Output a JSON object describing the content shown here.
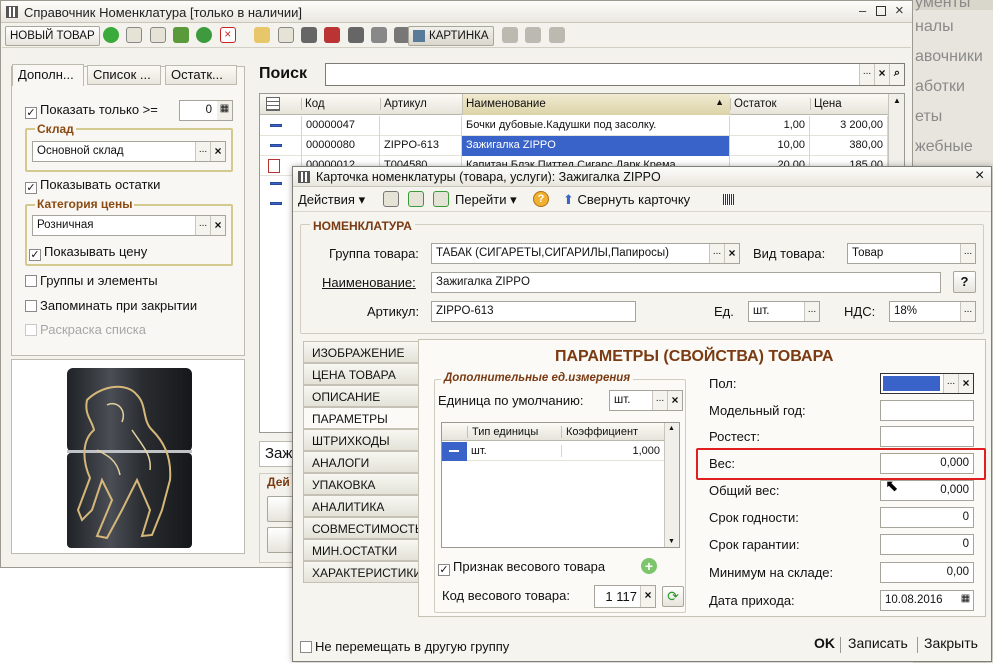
{
  "background_window": {
    "menu_items": [
      "ументы",
      "налы",
      "авочники",
      "аботки",
      "еты",
      "жебные"
    ]
  },
  "catalog_window": {
    "title": "Справочник Номенклатура [только в наличии]",
    "toolbar": {
      "new_item": "НОВЫЙ ТОВАР",
      "picture": "КАРТИНКА"
    },
    "tabs": [
      "Дополн...",
      "Список ...",
      "Остатк..."
    ],
    "search_label": "Поиск",
    "search_value": "",
    "filters": {
      "show_only_label": "Показать только >=",
      "show_only_value": "0",
      "warehouse_group": "Склад",
      "warehouse_value": "Основной склад",
      "show_stock": "Показывать остатки",
      "price_category_group": "Категория цены",
      "price_category_value": "Розничная",
      "show_price": "Показывать цену",
      "groups_elements": "Группы и элементы",
      "remember_on_close": "Запоминать при закрытии",
      "color_list": "Раскраска списка"
    },
    "table": {
      "headers": [
        "Код",
        "Артикул",
        "Наименование",
        "Остаток",
        "Цена"
      ],
      "rows": [
        {
          "code": "00000047",
          "article": "",
          "name": "Бочки дубовые.Кадушки под засолку.",
          "stock": "1,00",
          "price": "3 200,00"
        },
        {
          "code": "00000080",
          "article": "ZIPPO-613",
          "name": "Зажигалка ZIPPO",
          "stock": "10,00",
          "price": "380,00"
        },
        {
          "code": "00000012",
          "article": "T004580",
          "name": "Капитан Блэк Питтед Сигарс Дарк Крема",
          "stock": "20,00",
          "price": "185,00"
        }
      ]
    },
    "partial_text_1": "Заж",
    "partial_text_2": "Дей"
  },
  "card_window": {
    "title": "Карточка номенклатуры (товара, услуги): Зажигалка ZIPPO",
    "toolbar": {
      "actions": "Действия",
      "goto": "Перейти",
      "collapse": "Свернуть карточку"
    },
    "section_title": "НОМЕНКЛАТУРА",
    "group_label": "Группа товара:",
    "group_value": "ТАБАК (СИГАРЕТЫ,СИГАРИЛЫ,Папиросы)",
    "kind_label": "Вид товара:",
    "kind_value": "Товар",
    "name_label": "Наименование:",
    "name_value": "Зажигалка ZIPPO",
    "help": "?",
    "article_label": "Артикул:",
    "article_value": "ZIPPO-613",
    "unit_label": "Ед.",
    "unit_value": "шт.",
    "vat_label": "НДС:",
    "vat_value": "18%",
    "side_tabs": [
      "ИЗОБРАЖЕНИЕ",
      "ЦЕНА ТОВАРА",
      "ОПИСАНИЕ",
      "ПАРАМЕТРЫ",
      "ШТРИХКОДЫ",
      "АНАЛОГИ",
      "УПАКОВКА",
      "АНАЛИТИКА",
      "СОВМЕСТИМОСТЬ",
      "МИН.ОСТАТКИ",
      "ХАРАКТЕРИСТИКИ"
    ],
    "params_title": "ПАРАМЕТРЫ (СВОЙСТВА) ТОВАРА",
    "units_group": "Дополнительные ед.измерения",
    "default_unit_label": "Единица по умолчанию:",
    "default_unit_value": "шт.",
    "units_table": {
      "headers": [
        "Тип единицы",
        "Коэффициент"
      ],
      "rows": [
        {
          "type": "шт.",
          "coef": "1,000"
        }
      ]
    },
    "weighted_label": "Признак весового товара",
    "weighted_code_label": "Код весового товара:",
    "weighted_code_value": "1 117",
    "properties": [
      {
        "label": "Пол:",
        "value": ""
      },
      {
        "label": "Модельный год:",
        "value": ""
      },
      {
        "label": "Ростест:",
        "value": ""
      },
      {
        "label": "Вес:",
        "value": "0,000"
      },
      {
        "label": "Общий вес:",
        "value": "0,000"
      },
      {
        "label": "Срок годности:",
        "value": "0"
      },
      {
        "label": "Срок гарантии:",
        "value": "0"
      },
      {
        "label": "Минимум на складе:",
        "value": "0,00"
      },
      {
        "label": "Дата прихода:",
        "value": "10.08.2016"
      }
    ],
    "no_move_label": "Не перемещать в другую группу",
    "ok": "OK",
    "save": "Записать",
    "close": "Закрыть"
  },
  "colors": {
    "highlight": "#e02020",
    "selection": "#3a63c9",
    "title_text": "#7a3a12"
  }
}
